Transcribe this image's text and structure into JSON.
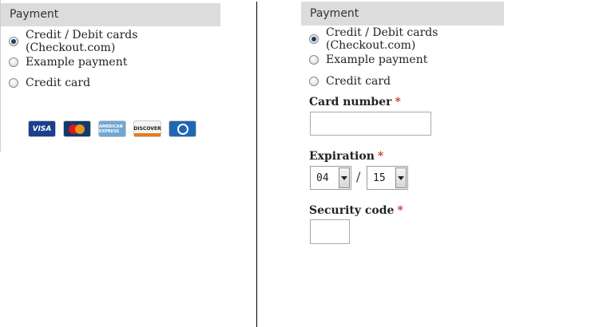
{
  "left_panel": {
    "header": "Payment",
    "options": [
      {
        "label": "Credit / Debit cards (Checkout.com)",
        "checked": true
      },
      {
        "label": "Example payment",
        "checked": false
      },
      {
        "label": "Credit card",
        "checked": false
      }
    ],
    "card_logos": [
      {
        "name": "visa-logo",
        "text": "VISA"
      },
      {
        "name": "mastercard-logo",
        "text": ""
      },
      {
        "name": "amex-logo",
        "text": "AMERICAN EXPRESS"
      },
      {
        "name": "discover-logo",
        "text": "DISCOVER"
      },
      {
        "name": "diners-logo",
        "text": ""
      }
    ]
  },
  "right_panel": {
    "header": "Payment",
    "options": [
      {
        "label": "Credit / Debit cards (Checkout.com)",
        "checked": true
      },
      {
        "label": "Example payment",
        "checked": false
      },
      {
        "label": "Credit card",
        "checked": false
      }
    ],
    "card_number_label": "Card number",
    "expiration_label": "Expiration",
    "security_code_label": "Security code",
    "required_mark": "*",
    "expiration_month": "04",
    "expiration_separator": "/",
    "expiration_year": "15"
  },
  "colors": {
    "header_bg": "#dcdcdc",
    "required": "#c0392b",
    "radio_checked": "#1d3d6e"
  }
}
